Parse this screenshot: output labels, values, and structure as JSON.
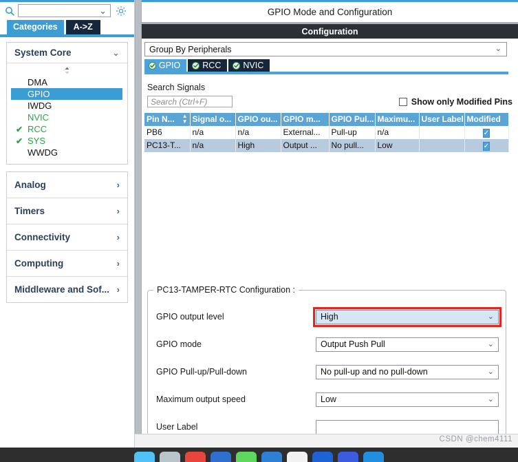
{
  "sidebar": {
    "search": {
      "value": "",
      "placeholder": "",
      "icon": "search-icon"
    },
    "gear_icon": "gear-icon",
    "tabs": [
      {
        "label": "Categories",
        "active": true
      },
      {
        "label": "A->Z",
        "active": false
      }
    ],
    "category_open": {
      "title": "System Core",
      "chevron": "chevron-down-icon",
      "items": [
        {
          "label": "DMA",
          "state": "normal",
          "check": ""
        },
        {
          "label": "GPIO",
          "state": "selected",
          "check": ""
        },
        {
          "label": "IWDG",
          "state": "normal",
          "check": ""
        },
        {
          "label": "NVIC",
          "state": "green",
          "check": ""
        },
        {
          "label": "RCC",
          "state": "green",
          "check": "✔"
        },
        {
          "label": "SYS",
          "state": "green",
          "check": "✔"
        },
        {
          "label": "WWDG",
          "state": "normal",
          "check": ""
        }
      ]
    },
    "categories_collapsed": [
      {
        "label": "Analog",
        "chevron": "chevron-right-icon"
      },
      {
        "label": "Timers",
        "chevron": "chevron-right-icon"
      },
      {
        "label": "Connectivity",
        "chevron": "chevron-right-icon"
      },
      {
        "label": "Computing",
        "chevron": "chevron-right-icon"
      },
      {
        "label": "Middleware and Sof...",
        "chevron": "chevron-right-icon"
      }
    ]
  },
  "main": {
    "title": "GPIO Mode and Configuration",
    "config_bar": "Configuration",
    "group_select": {
      "value": "Group By Peripherals",
      "caret": "chevron-down-icon"
    },
    "peripheral_tabs": [
      {
        "label": "GPIO",
        "active": true,
        "icon": "check-circle-icon"
      },
      {
        "label": "RCC",
        "active": false,
        "icon": "check-circle-icon"
      },
      {
        "label": "NVIC",
        "active": false,
        "icon": "check-circle-icon"
      }
    ],
    "search_signals": {
      "label": "Search Signals",
      "placeholder": "Search (Ctrl+F)",
      "value": ""
    },
    "show_modified": {
      "label": "Show only Modified Pins",
      "checked": false
    },
    "table": {
      "columns": [
        "Pin N...",
        "Signal o...",
        "GPIO ou...",
        "GPIO m...",
        "GPIO Pul...",
        "Maximu...",
        "User Label",
        "Modified"
      ],
      "sort_column": "Pin N...",
      "rows": [
        {
          "pin": "PB6",
          "signal": "n/a",
          "output": "n/a",
          "mode": "External...",
          "pull": "Pull-up",
          "speed": "n/a",
          "user_label": "",
          "modified": true,
          "selected": false
        },
        {
          "pin": "PC13-T...",
          "signal": "n/a",
          "output": "High",
          "mode": "Output ...",
          "pull": "No pull...",
          "speed": "Low",
          "user_label": "",
          "modified": true,
          "selected": true
        }
      ]
    },
    "config_group": {
      "legend": "PC13-TAMPER-RTC Configuration :",
      "fields": [
        {
          "label": "GPIO output level",
          "value": "High",
          "type": "select",
          "highlighted": true
        },
        {
          "label": "GPIO mode",
          "value": "Output Push Pull",
          "type": "select",
          "highlighted": false
        },
        {
          "label": "GPIO Pull-up/Pull-down",
          "value": "No pull-up and no pull-down",
          "type": "select",
          "highlighted": false
        },
        {
          "label": "Maximum output speed",
          "value": "Low",
          "type": "select",
          "highlighted": false
        },
        {
          "label": "User Label",
          "value": "",
          "type": "text",
          "highlighted": false
        }
      ]
    }
  },
  "overlay": {
    "watermark": "CSDN @chem4111"
  },
  "colors": {
    "accent_blue": "#3c9dd4",
    "tab_active": "#4ba3d9",
    "tab_inactive": "#16263b",
    "table_header": "#5ba5d6",
    "row_selected": "#b8cade",
    "green": "#2aa44a",
    "highlight_red": "#e8231f",
    "dark_bar": "#2b3034"
  }
}
